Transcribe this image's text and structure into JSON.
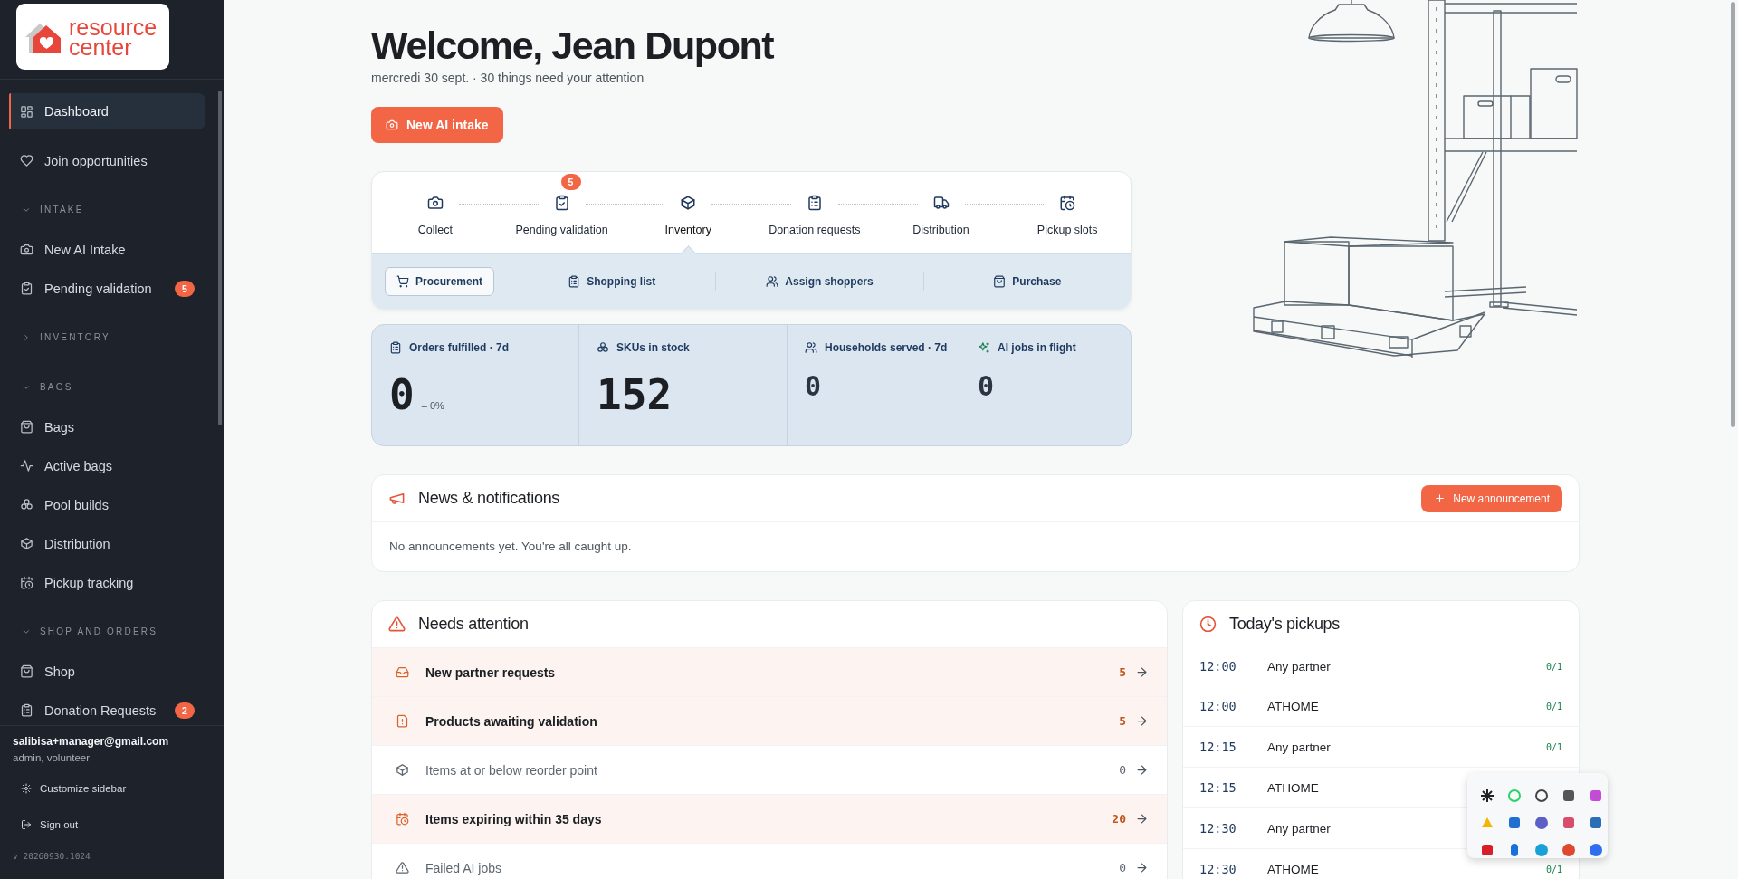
{
  "sidebar": {
    "logo": {
      "text": "resource center"
    },
    "items": [
      {
        "kind": "link",
        "label": "Dashboard",
        "selected": true
      },
      {
        "kind": "link",
        "label": "Join opportunities",
        "selected": false
      },
      {
        "kind": "section",
        "label": "INTAKE",
        "expanded": true
      },
      {
        "kind": "link",
        "label": "New AI Intake",
        "selected": false
      },
      {
        "kind": "link",
        "label": "Pending validation",
        "selected": false,
        "badge": "5"
      },
      {
        "kind": "section",
        "label": "INVENTORY",
        "expanded": false
      },
      {
        "kind": "section",
        "label": "BAGS",
        "expanded": true
      },
      {
        "kind": "link",
        "label": "Bags",
        "selected": false
      },
      {
        "kind": "link",
        "label": "Active bags",
        "selected": false
      },
      {
        "kind": "link",
        "label": "Pool builds",
        "selected": false
      },
      {
        "kind": "link",
        "label": "Distribution",
        "selected": false
      },
      {
        "kind": "link",
        "label": "Pickup tracking",
        "selected": false
      },
      {
        "kind": "section",
        "label": "SHOP AND ORDERS",
        "expanded": true
      },
      {
        "kind": "link",
        "label": "Shop",
        "selected": false
      },
      {
        "kind": "link",
        "label": "Donation Requests",
        "selected": false,
        "badge": "2"
      }
    ],
    "user": {
      "email": "salibisa+manager@gmail.com",
      "roles": "admin, volunteer"
    },
    "footer_links": [
      "Customize sidebar",
      "Sign out"
    ],
    "version": "v 20260930.1024"
  },
  "header": {
    "title": "Welcome, Jean Dupont",
    "subtitle": "mercredi 30 sept. · 30 things need your attention",
    "action": "New AI intake"
  },
  "workflow": {
    "steps": [
      {
        "label": "Collect",
        "selected": false
      },
      {
        "label": "Pending validation",
        "selected": false,
        "badge": "5"
      },
      {
        "label": "Inventory",
        "selected": true
      },
      {
        "label": "Donation requests",
        "selected": false
      },
      {
        "label": "Distribution",
        "selected": false
      },
      {
        "label": "Pickup slots",
        "selected": false
      }
    ],
    "subtabs": [
      {
        "label": "Procurement",
        "selected": true
      },
      {
        "label": "Shopping list",
        "selected": false
      },
      {
        "label": "Assign shoppers",
        "selected": false
      },
      {
        "label": "Purchase",
        "selected": false
      }
    ]
  },
  "stats": [
    {
      "label": "Orders fulfilled · 7d",
      "value": "0",
      "delta": "– 0%",
      "kind": "primary"
    },
    {
      "label": "SKUs in stock",
      "value": "152",
      "kind": "primary"
    },
    {
      "label": "Households served · 7d",
      "value": "0",
      "kind": "secondary"
    },
    {
      "label": "AI jobs in flight",
      "value": "0",
      "kind": "secondary"
    }
  ],
  "news": {
    "title": "News & notifications",
    "action": "New announcement",
    "empty": "No announcements yet. You're all caught up."
  },
  "attention": {
    "title": "Needs attention",
    "items": [
      {
        "label": "New partner requests",
        "count": "5",
        "urgent": true
      },
      {
        "label": "Products awaiting validation",
        "count": "5",
        "urgent": true
      },
      {
        "label": "Items at or below reorder point",
        "count": "0",
        "urgent": false
      },
      {
        "label": "Items expiring within 35 days",
        "count": "20",
        "urgent": true
      },
      {
        "label": "Failed AI jobs",
        "count": "0",
        "urgent": false
      }
    ]
  },
  "pickups": {
    "title": "Today's pickups",
    "rows": [
      {
        "time": "12:00",
        "partner": "Any partner",
        "slots": "0/1"
      },
      {
        "time": "12:00",
        "partner": "ATHOME",
        "slots": "0/1"
      },
      {
        "time": "12:15",
        "partner": "Any partner",
        "slots": "0/1"
      },
      {
        "time": "12:15",
        "partner": "ATHOME"
      },
      {
        "time": "12:30",
        "partner": "Any partner"
      },
      {
        "time": "12:30",
        "partner": "ATHOME",
        "slots": "0/1"
      }
    ]
  }
}
